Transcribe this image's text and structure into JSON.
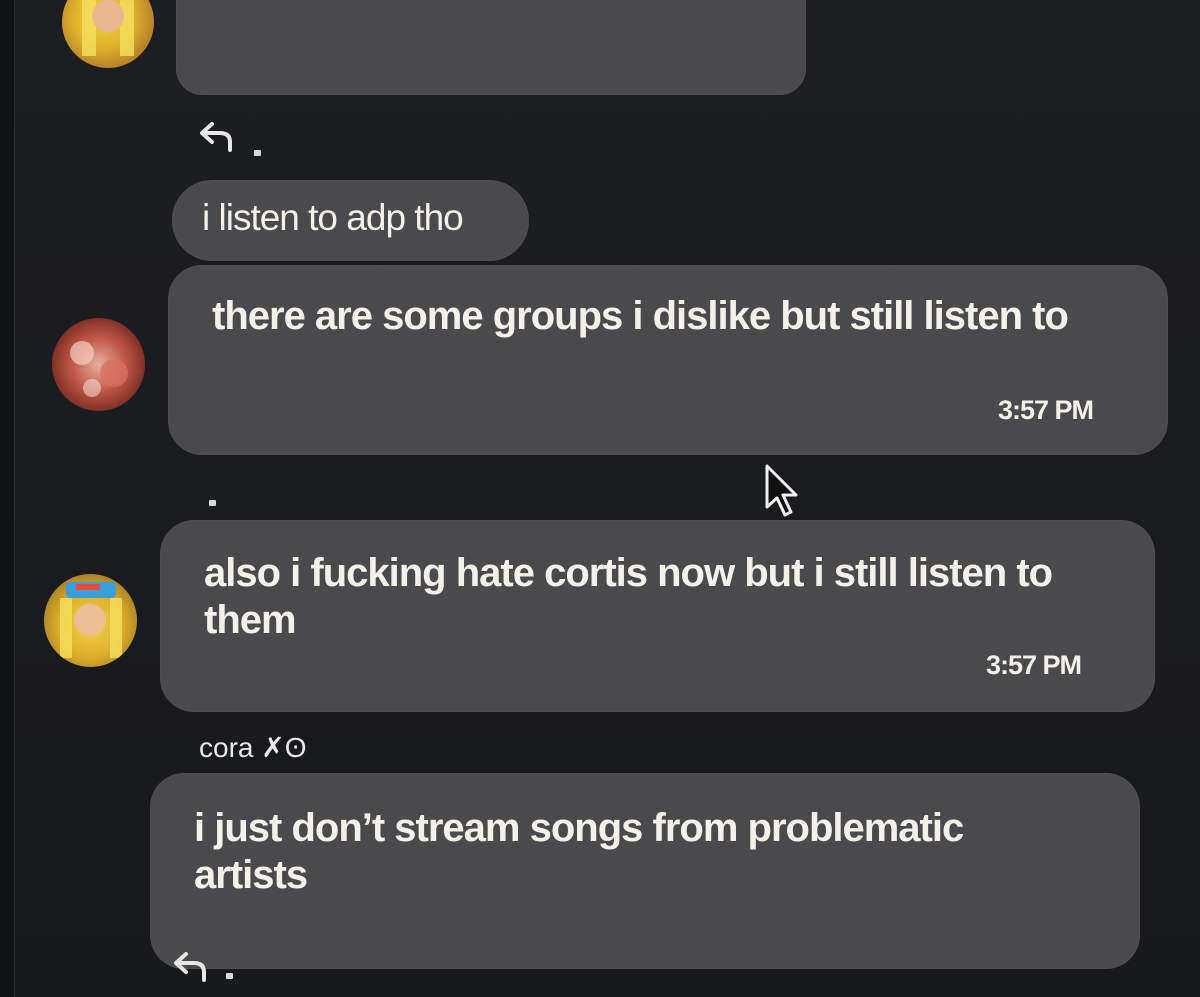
{
  "messages": [
    {
      "text": "i listen to adp tho"
    },
    {
      "text": "there are some groups i dislike but still listen to",
      "time": "3:57 PM"
    },
    {
      "text": "also i fucking hate cortis now but i still listen to them",
      "time": "3:57 PM"
    },
    {
      "text": "i just don’t stream songs from problematic artists"
    }
  ],
  "usernames": {
    "cora": "cora ✗ʘ"
  },
  "icons": [
    "reply-icon",
    "mouse-cursor-icon"
  ],
  "colors": {
    "background": "#1b1c1f",
    "bubble": "#4a4a4c",
    "text": "#f4f0ea"
  }
}
